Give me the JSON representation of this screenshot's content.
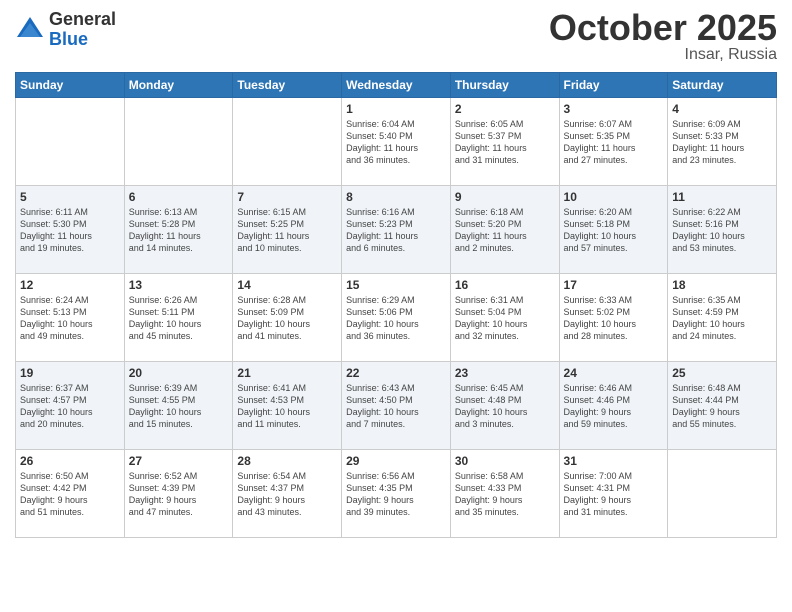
{
  "logo": {
    "general": "General",
    "blue": "Blue"
  },
  "header": {
    "month": "October 2025",
    "location": "Insar, Russia"
  },
  "weekdays": [
    "Sunday",
    "Monday",
    "Tuesday",
    "Wednesday",
    "Thursday",
    "Friday",
    "Saturday"
  ],
  "weeks": [
    [
      {
        "day": "",
        "info": ""
      },
      {
        "day": "",
        "info": ""
      },
      {
        "day": "",
        "info": ""
      },
      {
        "day": "1",
        "info": "Sunrise: 6:04 AM\nSunset: 5:40 PM\nDaylight: 11 hours\nand 36 minutes."
      },
      {
        "day": "2",
        "info": "Sunrise: 6:05 AM\nSunset: 5:37 PM\nDaylight: 11 hours\nand 31 minutes."
      },
      {
        "day": "3",
        "info": "Sunrise: 6:07 AM\nSunset: 5:35 PM\nDaylight: 11 hours\nand 27 minutes."
      },
      {
        "day": "4",
        "info": "Sunrise: 6:09 AM\nSunset: 5:33 PM\nDaylight: 11 hours\nand 23 minutes."
      }
    ],
    [
      {
        "day": "5",
        "info": "Sunrise: 6:11 AM\nSunset: 5:30 PM\nDaylight: 11 hours\nand 19 minutes."
      },
      {
        "day": "6",
        "info": "Sunrise: 6:13 AM\nSunset: 5:28 PM\nDaylight: 11 hours\nand 14 minutes."
      },
      {
        "day": "7",
        "info": "Sunrise: 6:15 AM\nSunset: 5:25 PM\nDaylight: 11 hours\nand 10 minutes."
      },
      {
        "day": "8",
        "info": "Sunrise: 6:16 AM\nSunset: 5:23 PM\nDaylight: 11 hours\nand 6 minutes."
      },
      {
        "day": "9",
        "info": "Sunrise: 6:18 AM\nSunset: 5:20 PM\nDaylight: 11 hours\nand 2 minutes."
      },
      {
        "day": "10",
        "info": "Sunrise: 6:20 AM\nSunset: 5:18 PM\nDaylight: 10 hours\nand 57 minutes."
      },
      {
        "day": "11",
        "info": "Sunrise: 6:22 AM\nSunset: 5:16 PM\nDaylight: 10 hours\nand 53 minutes."
      }
    ],
    [
      {
        "day": "12",
        "info": "Sunrise: 6:24 AM\nSunset: 5:13 PM\nDaylight: 10 hours\nand 49 minutes."
      },
      {
        "day": "13",
        "info": "Sunrise: 6:26 AM\nSunset: 5:11 PM\nDaylight: 10 hours\nand 45 minutes."
      },
      {
        "day": "14",
        "info": "Sunrise: 6:28 AM\nSunset: 5:09 PM\nDaylight: 10 hours\nand 41 minutes."
      },
      {
        "day": "15",
        "info": "Sunrise: 6:29 AM\nSunset: 5:06 PM\nDaylight: 10 hours\nand 36 minutes."
      },
      {
        "day": "16",
        "info": "Sunrise: 6:31 AM\nSunset: 5:04 PM\nDaylight: 10 hours\nand 32 minutes."
      },
      {
        "day": "17",
        "info": "Sunrise: 6:33 AM\nSunset: 5:02 PM\nDaylight: 10 hours\nand 28 minutes."
      },
      {
        "day": "18",
        "info": "Sunrise: 6:35 AM\nSunset: 4:59 PM\nDaylight: 10 hours\nand 24 minutes."
      }
    ],
    [
      {
        "day": "19",
        "info": "Sunrise: 6:37 AM\nSunset: 4:57 PM\nDaylight: 10 hours\nand 20 minutes."
      },
      {
        "day": "20",
        "info": "Sunrise: 6:39 AM\nSunset: 4:55 PM\nDaylight: 10 hours\nand 15 minutes."
      },
      {
        "day": "21",
        "info": "Sunrise: 6:41 AM\nSunset: 4:53 PM\nDaylight: 10 hours\nand 11 minutes."
      },
      {
        "day": "22",
        "info": "Sunrise: 6:43 AM\nSunset: 4:50 PM\nDaylight: 10 hours\nand 7 minutes."
      },
      {
        "day": "23",
        "info": "Sunrise: 6:45 AM\nSunset: 4:48 PM\nDaylight: 10 hours\nand 3 minutes."
      },
      {
        "day": "24",
        "info": "Sunrise: 6:46 AM\nSunset: 4:46 PM\nDaylight: 9 hours\nand 59 minutes."
      },
      {
        "day": "25",
        "info": "Sunrise: 6:48 AM\nSunset: 4:44 PM\nDaylight: 9 hours\nand 55 minutes."
      }
    ],
    [
      {
        "day": "26",
        "info": "Sunrise: 6:50 AM\nSunset: 4:42 PM\nDaylight: 9 hours\nand 51 minutes."
      },
      {
        "day": "27",
        "info": "Sunrise: 6:52 AM\nSunset: 4:39 PM\nDaylight: 9 hours\nand 47 minutes."
      },
      {
        "day": "28",
        "info": "Sunrise: 6:54 AM\nSunset: 4:37 PM\nDaylight: 9 hours\nand 43 minutes."
      },
      {
        "day": "29",
        "info": "Sunrise: 6:56 AM\nSunset: 4:35 PM\nDaylight: 9 hours\nand 39 minutes."
      },
      {
        "day": "30",
        "info": "Sunrise: 6:58 AM\nSunset: 4:33 PM\nDaylight: 9 hours\nand 35 minutes."
      },
      {
        "day": "31",
        "info": "Sunrise: 7:00 AM\nSunset: 4:31 PM\nDaylight: 9 hours\nand 31 minutes."
      },
      {
        "day": "",
        "info": ""
      }
    ]
  ]
}
